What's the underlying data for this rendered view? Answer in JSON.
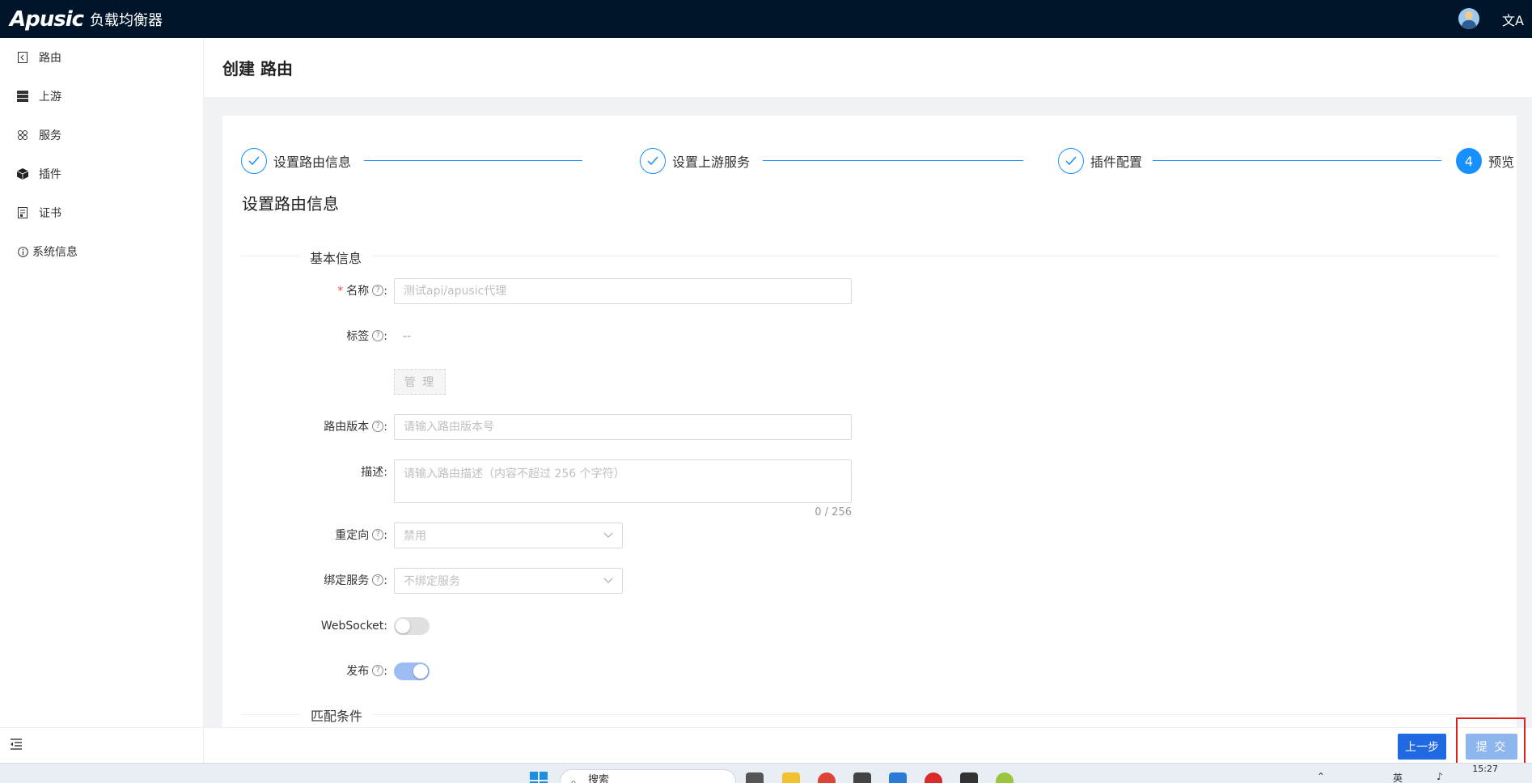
{
  "app": {
    "logo": "Apusic",
    "title": "负载均衡器",
    "lang_icon": "文A"
  },
  "sidebar": {
    "items": [
      {
        "label": "路由",
        "icon": "route-icon"
      },
      {
        "label": "上游",
        "icon": "upstream-icon"
      },
      {
        "label": "服务",
        "icon": "service-icon"
      },
      {
        "label": "插件",
        "icon": "plugin-icon"
      },
      {
        "label": "证书",
        "icon": "certificate-icon"
      },
      {
        "label": "系统信息",
        "icon": "info-icon"
      }
    ],
    "collapse_icon": "menu-fold-icon"
  },
  "page": {
    "title": "创建 路由"
  },
  "steps": [
    {
      "label": "设置路由信息",
      "status": "done"
    },
    {
      "label": "设置上游服务",
      "status": "done"
    },
    {
      "label": "插件配置",
      "status": "done"
    },
    {
      "label": "预览",
      "number": "4",
      "status": "active"
    }
  ],
  "section_title": "设置路由信息",
  "basic_info": {
    "header": "基本信息",
    "name": {
      "label": "名称",
      "placeholder": "测试api/apusic代理"
    },
    "tags": {
      "label": "标签",
      "value": "--",
      "manage_label": "管 理"
    },
    "version": {
      "label": "路由版本",
      "placeholder": "请输入路由版本号"
    },
    "description": {
      "label": "描述",
      "placeholder": "请输入路由描述（内容不超过 256 个字符）",
      "count": "0 / 256"
    },
    "redirect": {
      "label": "重定向",
      "value": "禁用"
    },
    "bind_service": {
      "label": "绑定服务",
      "value": "不绑定服务"
    },
    "websocket": {
      "label": "WebSocket",
      "on": false
    },
    "publish": {
      "label": "发布",
      "on": true
    }
  },
  "match_header": "匹配条件",
  "actions": {
    "prev_label": "上一步",
    "submit_label": "提 交"
  },
  "taskbar": {
    "search_label": "搜索",
    "tray_lang": "英",
    "clock": "15:27"
  }
}
